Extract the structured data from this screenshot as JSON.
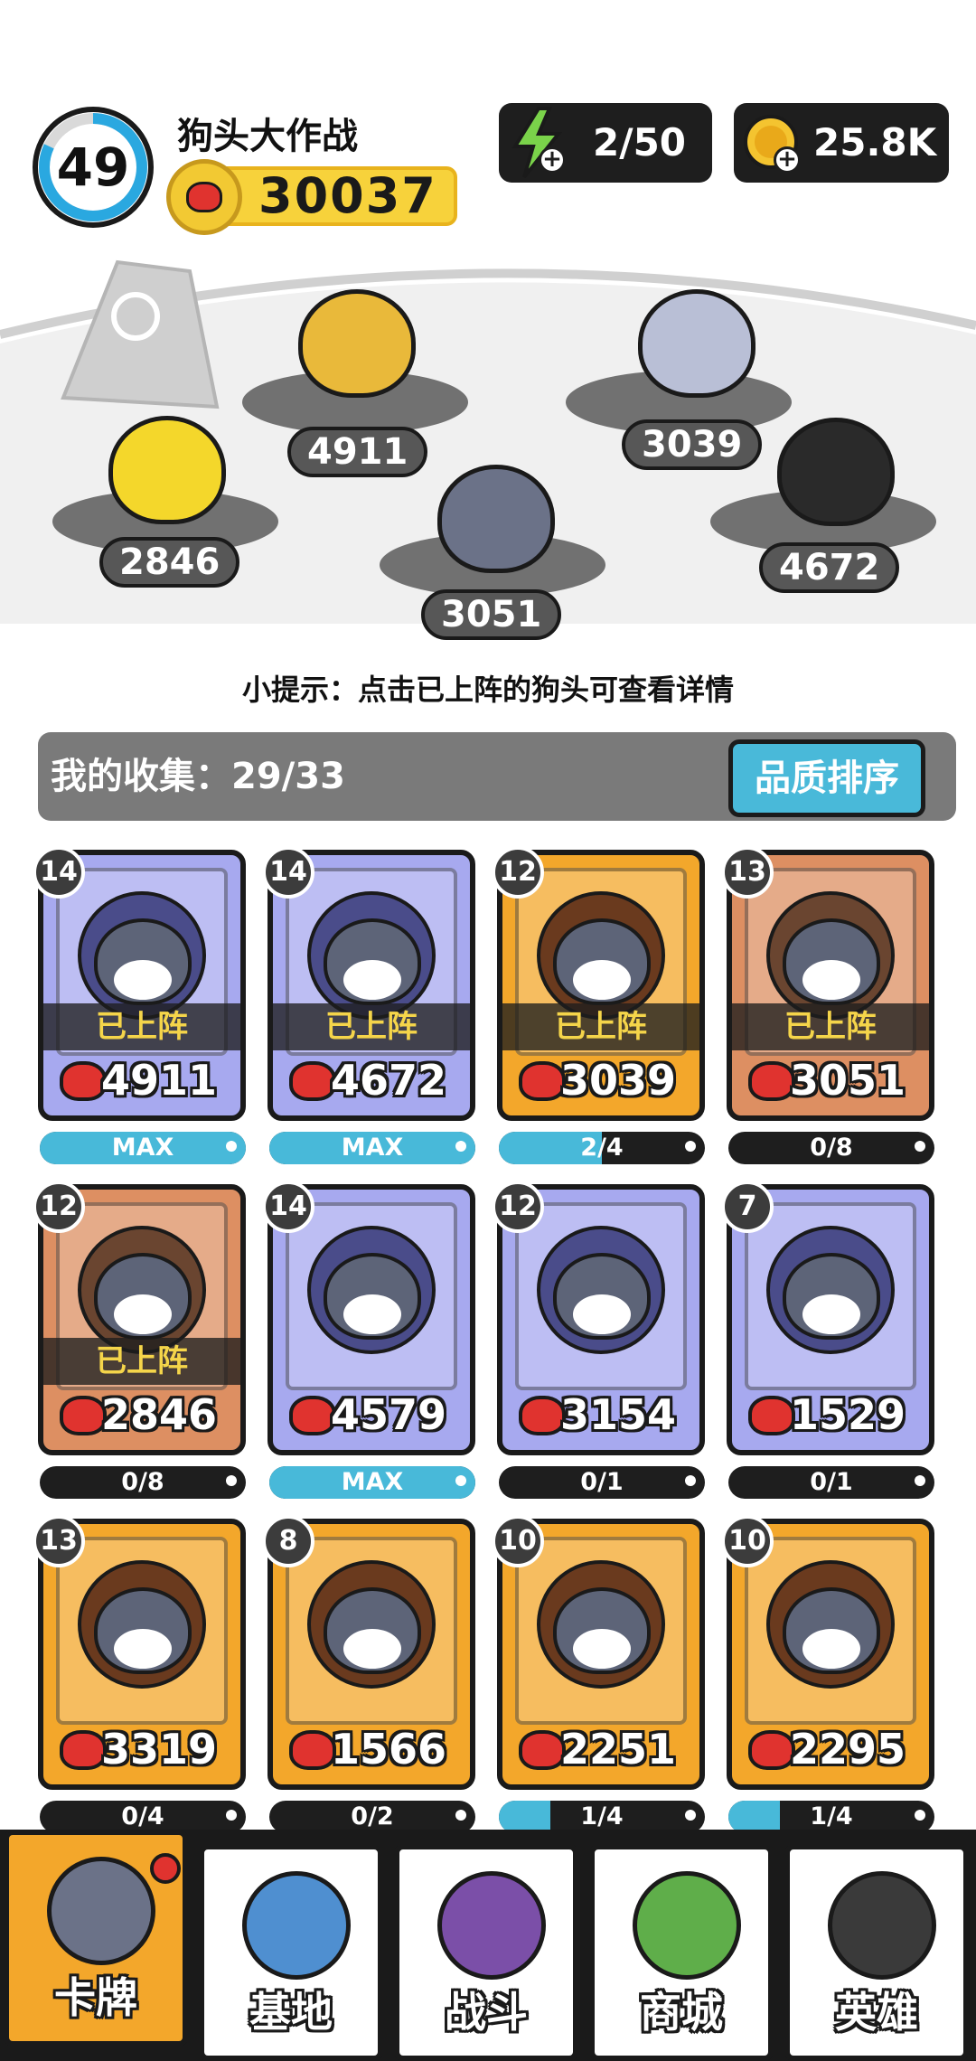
{
  "header": {
    "level": "49",
    "level_progress": 0.82,
    "title": "狗头大作战",
    "power": "30037",
    "energy": "2/50",
    "coins": "25.8K"
  },
  "arena": {
    "pets": [
      {
        "power": "4911",
        "color": "#e9b93a"
      },
      {
        "power": "3039",
        "color": "#b9bfd6"
      },
      {
        "power": "2846",
        "color": "#f4d72b"
      },
      {
        "power": "4672",
        "color": "#2a2a2a"
      },
      {
        "power": "3051",
        "color": "#6b7288"
      }
    ],
    "hint": "小提示：点击已上阵的狗头可查看详情"
  },
  "collection": {
    "label": "我的收集：29/33",
    "sort_button": "品质排序"
  },
  "cards": [
    {
      "level": "14",
      "power": "4911",
      "deployed": "已上阵",
      "progress": "MAX",
      "fill": 1.0,
      "rarity": "blue"
    },
    {
      "level": "14",
      "power": "4672",
      "deployed": "已上阵",
      "progress": "MAX",
      "fill": 1.0,
      "rarity": "blue"
    },
    {
      "level": "12",
      "power": "3039",
      "deployed": "已上阵",
      "progress": "2/4",
      "fill": 0.5,
      "rarity": "orange"
    },
    {
      "level": "13",
      "power": "3051",
      "deployed": "已上阵",
      "progress": "0/8",
      "fill": 0,
      "rarity": "copper"
    },
    {
      "level": "12",
      "power": "2846",
      "deployed": "已上阵",
      "progress": "0/8",
      "fill": 0,
      "rarity": "copper"
    },
    {
      "level": "14",
      "power": "4579",
      "deployed": "",
      "progress": "MAX",
      "fill": 1.0,
      "rarity": "blue"
    },
    {
      "level": "12",
      "power": "3154",
      "deployed": "",
      "progress": "0/1",
      "fill": 0,
      "rarity": "blue"
    },
    {
      "level": "7",
      "power": "1529",
      "deployed": "",
      "progress": "0/1",
      "fill": 0,
      "rarity": "blue"
    },
    {
      "level": "13",
      "power": "3319",
      "deployed": "",
      "progress": "0/4",
      "fill": 0,
      "rarity": "orange"
    },
    {
      "level": "8",
      "power": "1566",
      "deployed": "",
      "progress": "0/2",
      "fill": 0,
      "rarity": "orange"
    },
    {
      "level": "10",
      "power": "2251",
      "deployed": "",
      "progress": "1/4",
      "fill": 0.25,
      "rarity": "orange"
    },
    {
      "level": "10",
      "power": "2295",
      "deployed": "",
      "progress": "1/4",
      "fill": 0.25,
      "rarity": "orange"
    }
  ],
  "nav": {
    "tabs": [
      {
        "label": "卡牌",
        "icon": "dog-card-icon",
        "active": true,
        "color": "#6b7288"
      },
      {
        "label": "基地",
        "icon": "castle-icon",
        "active": false,
        "color": "#4f8fd0"
      },
      {
        "label": "战斗",
        "icon": "paw-icon",
        "active": false,
        "color": "#7b4fa8"
      },
      {
        "label": "商城",
        "icon": "money-icon",
        "active": false,
        "color": "#5fae4a"
      },
      {
        "label": "英雄",
        "icon": "hero-icon",
        "active": false,
        "color": "#3a3a3a"
      }
    ]
  }
}
